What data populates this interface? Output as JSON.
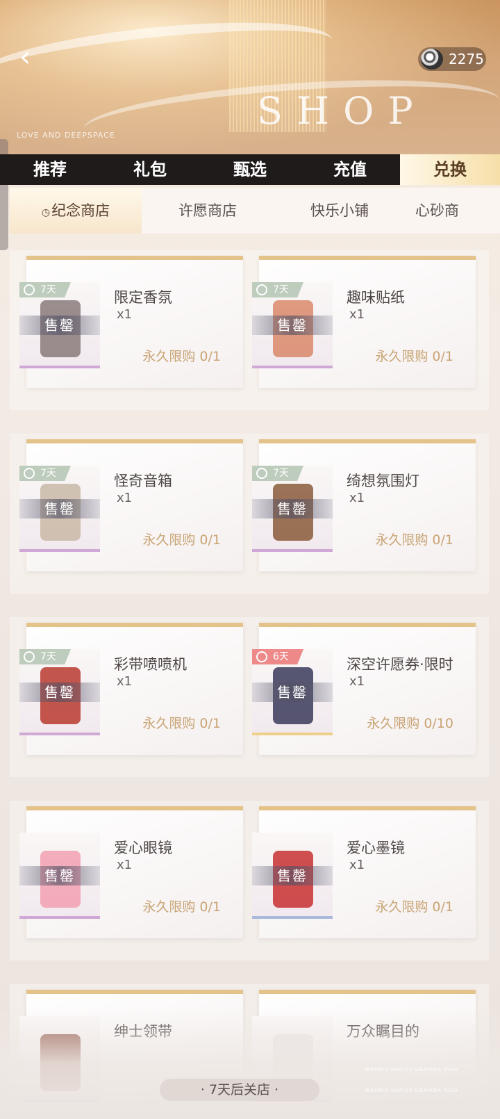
{
  "header": {
    "back_icon": "chevron-left-icon",
    "shop_word": "SHOP",
    "brand_mark": "LOVE AND DEEPSPACE",
    "currency_icon": "diamond-ring-icon",
    "currency_amount": "2275"
  },
  "main_tabs": [
    {
      "label": "推荐",
      "active": false
    },
    {
      "label": "礼包",
      "active": false
    },
    {
      "label": "甄选",
      "active": false
    },
    {
      "label": "充值",
      "active": false
    },
    {
      "label": "兑换",
      "active": true
    }
  ],
  "sub_tabs": [
    {
      "label": "纪念商店",
      "active": true,
      "icon": "clock-icon"
    },
    {
      "label": "许愿商店",
      "active": false
    },
    {
      "label": "快乐小铺",
      "active": false
    },
    {
      "label": "心砂商",
      "active": false
    }
  ],
  "items": [
    {
      "name": "限定香氛",
      "qty": "x1",
      "badge": "7天",
      "status": "售罄",
      "limit": "永久限购 0/1",
      "art_color": "#8a7a7a",
      "accent": "purple"
    },
    {
      "name": "趣味贴纸",
      "qty": "x1",
      "badge": "7天",
      "status": "售罄",
      "limit": "永久限购 0/1",
      "art_color": "#d9886a",
      "accent": "purple"
    },
    {
      "name": "怪奇音箱",
      "qty": "x1",
      "badge": "7天",
      "status": "售罄",
      "limit": "永久限购 0/1",
      "art_color": "#c9b8a6",
      "accent": "purple"
    },
    {
      "name": "绮想氛围灯",
      "qty": "x1",
      "badge": "7天",
      "status": "售罄",
      "limit": "永久限购 0/1",
      "art_color": "#8a5a3a",
      "accent": "purple"
    },
    {
      "name": "彩带喷喷机",
      "qty": "x1",
      "badge": "7天",
      "status": "售罄",
      "limit": "永久限购 0/1",
      "art_color": "#b83a2e",
      "accent": "purple"
    },
    {
      "name": "深空许愿券·限时",
      "qty": "x1",
      "badge": "6天",
      "status": "售罄",
      "limit": "永久限购 0/10",
      "art_color": "#3a3a5a",
      "accent": "gold"
    },
    {
      "name": "爱心眼镜",
      "qty": "x1",
      "badge": "",
      "status": "售罄",
      "limit": "永久限购 0/1",
      "art_color": "#f2a0b0",
      "accent": "purple"
    },
    {
      "name": "爱心墨镜",
      "qty": "x1",
      "badge": "",
      "status": "售罄",
      "limit": "永久限购 0/1",
      "art_color": "#c83030",
      "accent": "blue"
    },
    {
      "name": "绅士领带",
      "qty": "",
      "badge": "",
      "status": "",
      "limit": "",
      "art_color": "#8a4a3a",
      "accent": "purple"
    },
    {
      "name": "万众瞩目的",
      "qty": "",
      "badge": "",
      "status": "",
      "limit": "",
      "art_color": "#e8e0e0",
      "accent": "purple"
    }
  ],
  "footer": {
    "closing_text": "· 7天后关店 ·",
    "watermark": "MAURIS VARIUS GRAVIDA NISH"
  }
}
